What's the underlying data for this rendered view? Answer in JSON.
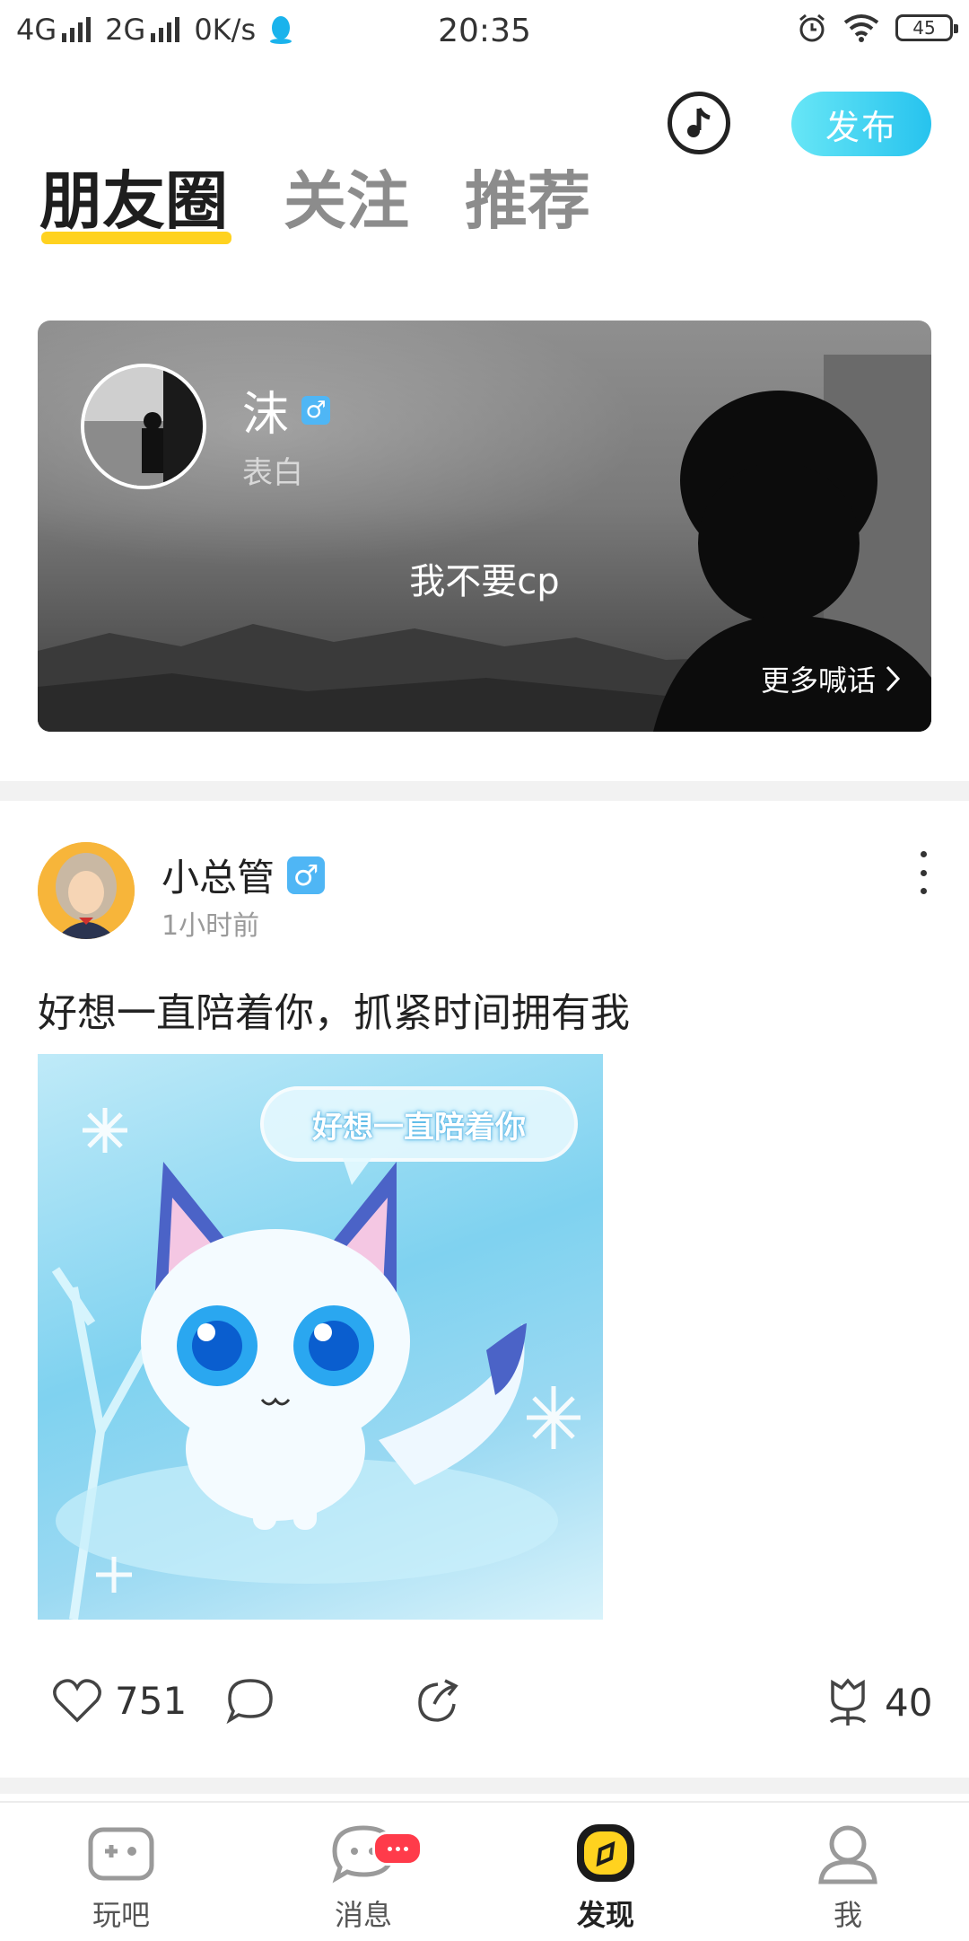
{
  "status_bar": {
    "network1": "4G",
    "network2": "2G",
    "speed": "0K/s",
    "time": "20:35",
    "battery": "45",
    "icons": [
      "qq-penguin-icon",
      "alarm-icon",
      "wifi-icon",
      "battery-icon"
    ]
  },
  "header": {
    "music_icon": "music-note-icon",
    "publish_label": "发布",
    "publish_color": "#3fd0f2"
  },
  "tabs": [
    {
      "label": "朋友圈",
      "active": true
    },
    {
      "label": "关注",
      "active": false
    },
    {
      "label": "推荐",
      "active": false
    }
  ],
  "accent_color": "#ffd21f",
  "banner": {
    "name": "沫",
    "gender": "♂",
    "subtitle": "表白",
    "quote": "我不要cp",
    "more_label": "更多喊话"
  },
  "post": {
    "author": "小总管",
    "gender": "♂",
    "time": "1小时前",
    "text": "好想一直陪着你，抓紧时间拥有我",
    "image_caption": "好想一直陪着你",
    "likes": "751",
    "gifts": "40"
  },
  "bottom_nav": [
    {
      "label": "玩吧",
      "icon": "gamepad-icon"
    },
    {
      "label": "消息",
      "icon": "chat-bubble-icon",
      "badge": "•••"
    },
    {
      "label": "发现",
      "icon": "discover-icon",
      "active": true
    },
    {
      "label": "我",
      "icon": "profile-icon"
    }
  ]
}
